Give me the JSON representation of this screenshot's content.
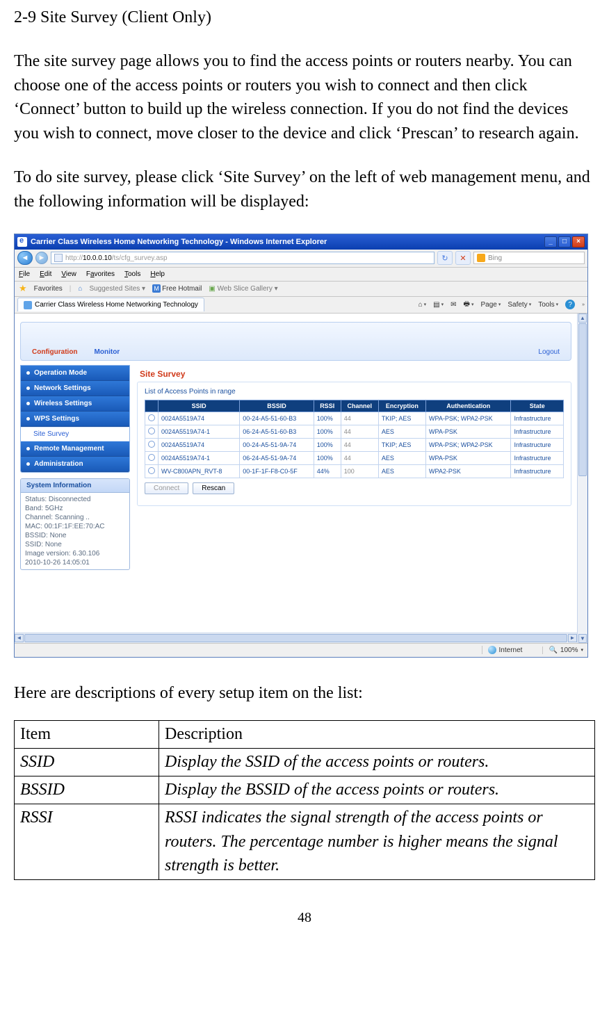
{
  "section_title": "2-9 Site Survey (Client Only)",
  "para1": "The site survey page allows you to find the access points or routers nearby. You can choose one of the access points or routers you wish to connect and then click ‘Connect’ button to build up the wireless connection. If you do not find the devices you wish to connect, move closer to the device and click ‘Prescan’ to research again.",
  "para2": "To do site survey, please click ‘Site Survey’ on the left of web management menu, and the following information will be displayed:",
  "outro": "Here are descriptions of every setup item on the list:",
  "browser": {
    "title": "Carrier Class Wireless Home Networking Technology - Windows Internet Explorer",
    "address_prefix": "http://",
    "address_host": "10.0.0.10",
    "address_path": "/ts/cfg_survey.asp",
    "search_placeholder": "Bing",
    "menu": {
      "file": "File",
      "edit": "Edit",
      "view": "View",
      "favorites": "Favorites",
      "tools": "Tools",
      "help": "Help"
    },
    "favbar": {
      "label": "Favorites",
      "suggested": "Suggested Sites",
      "hotmail": "Free Hotmail",
      "webslice": "Web Slice Gallery"
    },
    "tab_title": "Carrier Class Wireless Home Networking Technology",
    "tabtools": {
      "page": "Page",
      "safety": "Safety",
      "tools": "Tools"
    },
    "status": {
      "zone": "Internet",
      "zoom": "100%"
    }
  },
  "page": {
    "tabs": {
      "config": "Configuration",
      "monitor": "Monitor",
      "logout": "Logout"
    },
    "sidenav": {
      "op": "Operation Mode",
      "net": "Network Settings",
      "wifi": "Wireless Settings",
      "wps": "WPS Settings",
      "survey": "Site Survey",
      "remote": "Remote Management",
      "admin": "Administration"
    },
    "sysbox": {
      "title": "System Information",
      "lines": [
        "Status: Disconnected",
        "Band: 5GHz",
        "Channel: Scanning ..",
        "MAC: 00:1F:1F:EE:70:AC",
        "BSSID: None",
        "SSID: None",
        "Image version: 6.30.106",
        "2010-10-26 14:05:01"
      ]
    },
    "right": {
      "title": "Site Survey",
      "panel_title": "List of Access Points in range",
      "headers": [
        "SSID",
        "BSSID",
        "RSSI",
        "Channel",
        "Encryption",
        "Authentication",
        "State"
      ],
      "rows": [
        {
          "ssid": "0024A5519A74",
          "bssid": "00-24-A5-51-60-B3",
          "rssi": "100%",
          "ch": "44",
          "enc": "TKIP; AES",
          "auth": "WPA-PSK; WPA2-PSK",
          "state": "Infrastructure"
        },
        {
          "ssid": "0024A5519A74-1",
          "bssid": "06-24-A5-51-60-B3",
          "rssi": "100%",
          "ch": "44",
          "enc": "AES",
          "auth": "WPA-PSK",
          "state": "Infrastructure"
        },
        {
          "ssid": "0024A5519A74",
          "bssid": "00-24-A5-51-9A-74",
          "rssi": "100%",
          "ch": "44",
          "enc": "TKIP; AES",
          "auth": "WPA-PSK; WPA2-PSK",
          "state": "Infrastructure"
        },
        {
          "ssid": "0024A5519A74-1",
          "bssid": "06-24-A5-51-9A-74",
          "rssi": "100%",
          "ch": "44",
          "enc": "AES",
          "auth": "WPA-PSK",
          "state": "Infrastructure"
        },
        {
          "ssid": "WV-C800APN_RVT-8",
          "bssid": "00-1F-1F-F8-C0-5F",
          "rssi": "44%",
          "ch": "100",
          "enc": "AES",
          "auth": "WPA2-PSK",
          "state": "Infrastructure"
        }
      ],
      "connect_btn": "Connect",
      "rescan_btn": "Rescan"
    }
  },
  "desc_table": {
    "h_item": "Item",
    "h_desc": "Description",
    "rows": [
      {
        "item": "SSID",
        "desc": "Display the SSID of the access points or routers."
      },
      {
        "item": "BSSID",
        "desc": "Display the BSSID of the access points or routers."
      },
      {
        "item": "RSSI",
        "desc": "RSSI indicates the signal strength of the access points or routers. The percentage number is higher means the signal strength is better."
      }
    ]
  },
  "page_number": "48"
}
